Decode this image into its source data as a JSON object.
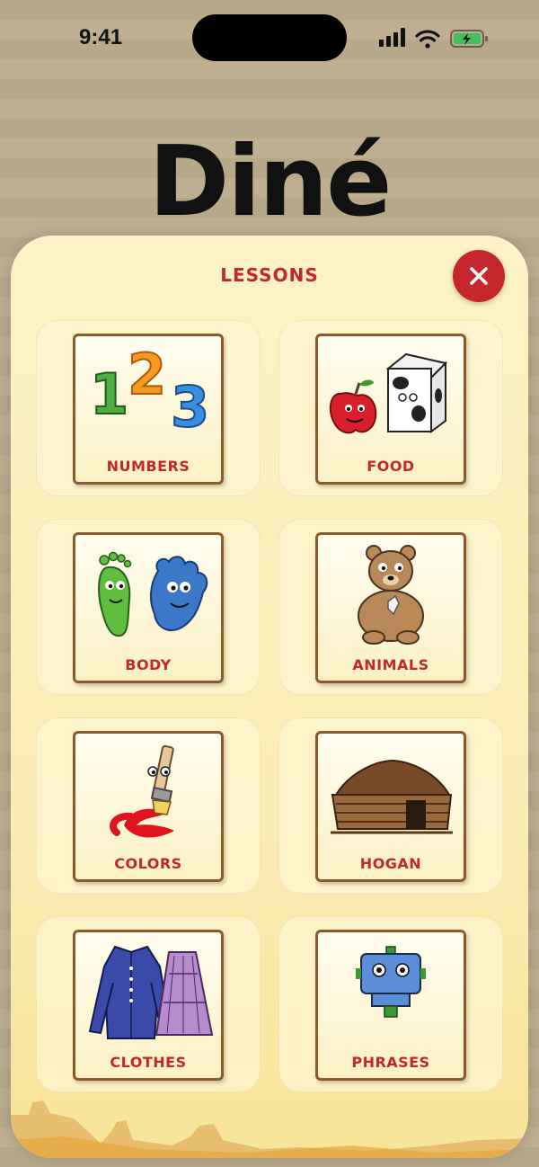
{
  "status": {
    "time": "9:41"
  },
  "app": {
    "title": "Diné"
  },
  "sheet": {
    "title": "LESSONS",
    "close_icon": "close-icon",
    "lessons": [
      {
        "label": "NUMBERS",
        "icon": "numbers-icon"
      },
      {
        "label": "FOOD",
        "icon": "food-icon"
      },
      {
        "label": "BODY",
        "icon": "body-icon"
      },
      {
        "label": "ANIMALS",
        "icon": "bear-icon"
      },
      {
        "label": "COLORS",
        "icon": "paintbrush-icon"
      },
      {
        "label": "HOGAN",
        "icon": "hogan-icon"
      },
      {
        "label": "CLOTHES",
        "icon": "clothes-icon"
      },
      {
        "label": "PHRASES",
        "icon": "robot-icon"
      }
    ]
  },
  "colors": {
    "accent": "#c4282c",
    "card_border": "#8a5a2b",
    "sheet_bg": "#fdf3c6"
  }
}
